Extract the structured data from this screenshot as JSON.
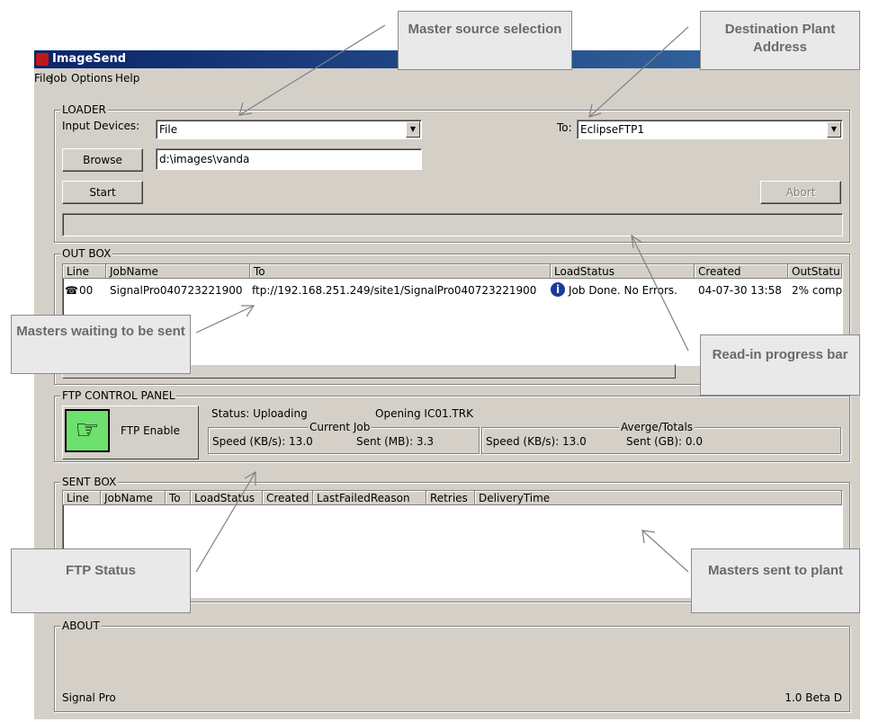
{
  "window": {
    "title": "ImageSend"
  },
  "menu": {
    "items": [
      "File",
      "Job",
      "Options",
      "Help"
    ]
  },
  "loader": {
    "legend": "LOADER",
    "input_devices_label": "Input Devices:",
    "input_device_value": "File",
    "to_label": "To:",
    "to_value": "EclipseFTP1",
    "browse_label": "Browse",
    "path_value": "d:\\images\\vanda",
    "start_label": "Start",
    "abort_label": "Abort"
  },
  "outbox": {
    "legend": "OUT BOX",
    "columns": [
      "Line",
      "JobName",
      "To",
      "LoadStatus",
      "Created",
      "OutStatu"
    ],
    "rows": [
      {
        "line": "00",
        "jobname": "SignalPro040723221900",
        "to": "ftp://192.168.251.249/site1/SignalPro040723221900",
        "loadstatus": "Job Done.  No Errors.",
        "created": "04-07-30 13:58",
        "outstatus": "2% comp"
      }
    ]
  },
  "ftp_panel": {
    "legend": "FTP CONTROL PANEL",
    "enable_label": "FTP Enable",
    "status_text": "Status: Uploading",
    "opening_text": "Opening IC01.TRK",
    "current_job": {
      "legend": "Current Job",
      "speed_text": "Speed (KB/s):  13.0",
      "sent_text": "Sent (MB):  3.3"
    },
    "totals": {
      "legend": "Averge/Totals",
      "speed_text": "Speed (KB/s):  13.0",
      "sent_text": "Sent (GB):  0.0"
    }
  },
  "sentbox": {
    "legend": "SENT BOX",
    "columns": [
      "Line",
      "JobName",
      "To",
      "LoadStatus",
      "Created",
      "LastFailedReason",
      "Retries",
      "DeliveryTime"
    ]
  },
  "about": {
    "legend": "ABOUT",
    "product": "Signal Pro",
    "version": "1.0 Beta D"
  },
  "callouts": {
    "master_source": "Master source selection",
    "destination": "Destination Plant Address",
    "masters_waiting": "Masters waiting to be sent",
    "readin_progress": "Read-in progress bar",
    "ftp_status": "FTP Status",
    "masters_sent": "Masters sent to plant"
  }
}
